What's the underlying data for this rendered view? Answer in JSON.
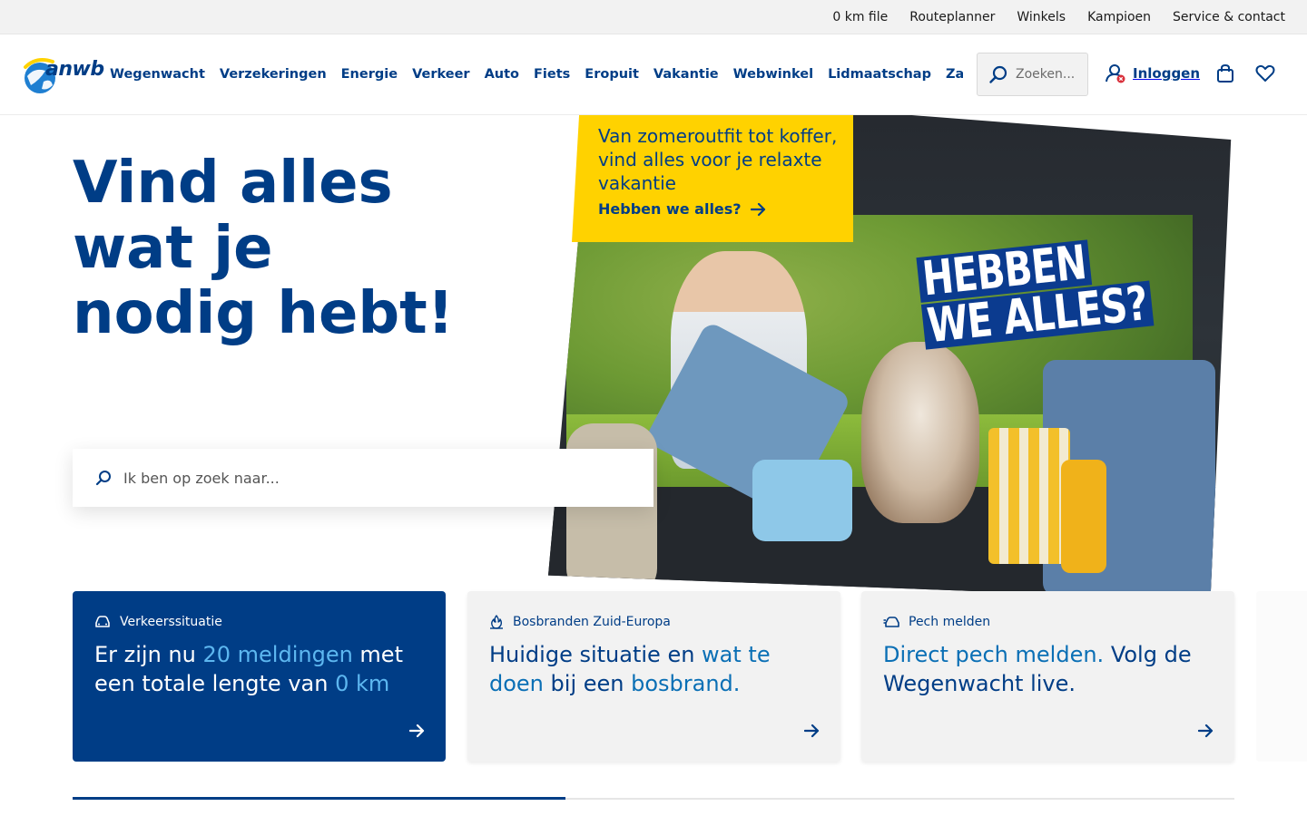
{
  "topbar": {
    "links": [
      "0 km file",
      "Routeplanner",
      "Winkels",
      "Kampioen",
      "Service & contact"
    ]
  },
  "nav": {
    "logo_text": "anwb",
    "links": [
      "Wegenwacht",
      "Verzekeringen",
      "Energie",
      "Verkeer",
      "Auto",
      "Fiets",
      "Eropuit",
      "Vakantie",
      "Webwinkel",
      "Lidmaatschap",
      "Zakelijk"
    ],
    "search_placeholder": "Zoeken...",
    "login_label": "Inloggen",
    "icons": [
      "search-icon",
      "user-icon",
      "shopping-bag-icon",
      "heart-icon"
    ]
  },
  "hero": {
    "title": "Vind alles wat je nodig hebt!",
    "search_placeholder": "Ik ben op zoek naar...",
    "photo_text_line1": "HEBBEN",
    "photo_text_line2": "WE ALLES?"
  },
  "promo": {
    "text": "Van zomeroutfit tot koffer, vind alles voor je relaxte vakantie",
    "cta": "Hebben we alles?"
  },
  "cards": [
    {
      "label": "Verkeerssituatie",
      "icon": "car-icon",
      "parts": [
        "Er zijn nu ",
        "20 meldingen",
        " met een totale lengte van ",
        "0 km"
      ]
    },
    {
      "label": "Bosbranden Zuid-Europa",
      "icon": "fire-icon",
      "parts": [
        "Huidige situatie",
        " en ",
        "wat te doen",
        " bij een ",
        "bosbrand."
      ]
    },
    {
      "label": "Pech melden",
      "icon": "car-breakdown-icon",
      "parts": [
        "Direct pech melden.",
        " Volg de Wegenwacht live."
      ]
    }
  ],
  "colors": {
    "brand_blue": "#003d86",
    "accent_yellow": "#ffd200",
    "light_link_blue": "#5db7f0",
    "link_blue": "#0a6fb5"
  }
}
